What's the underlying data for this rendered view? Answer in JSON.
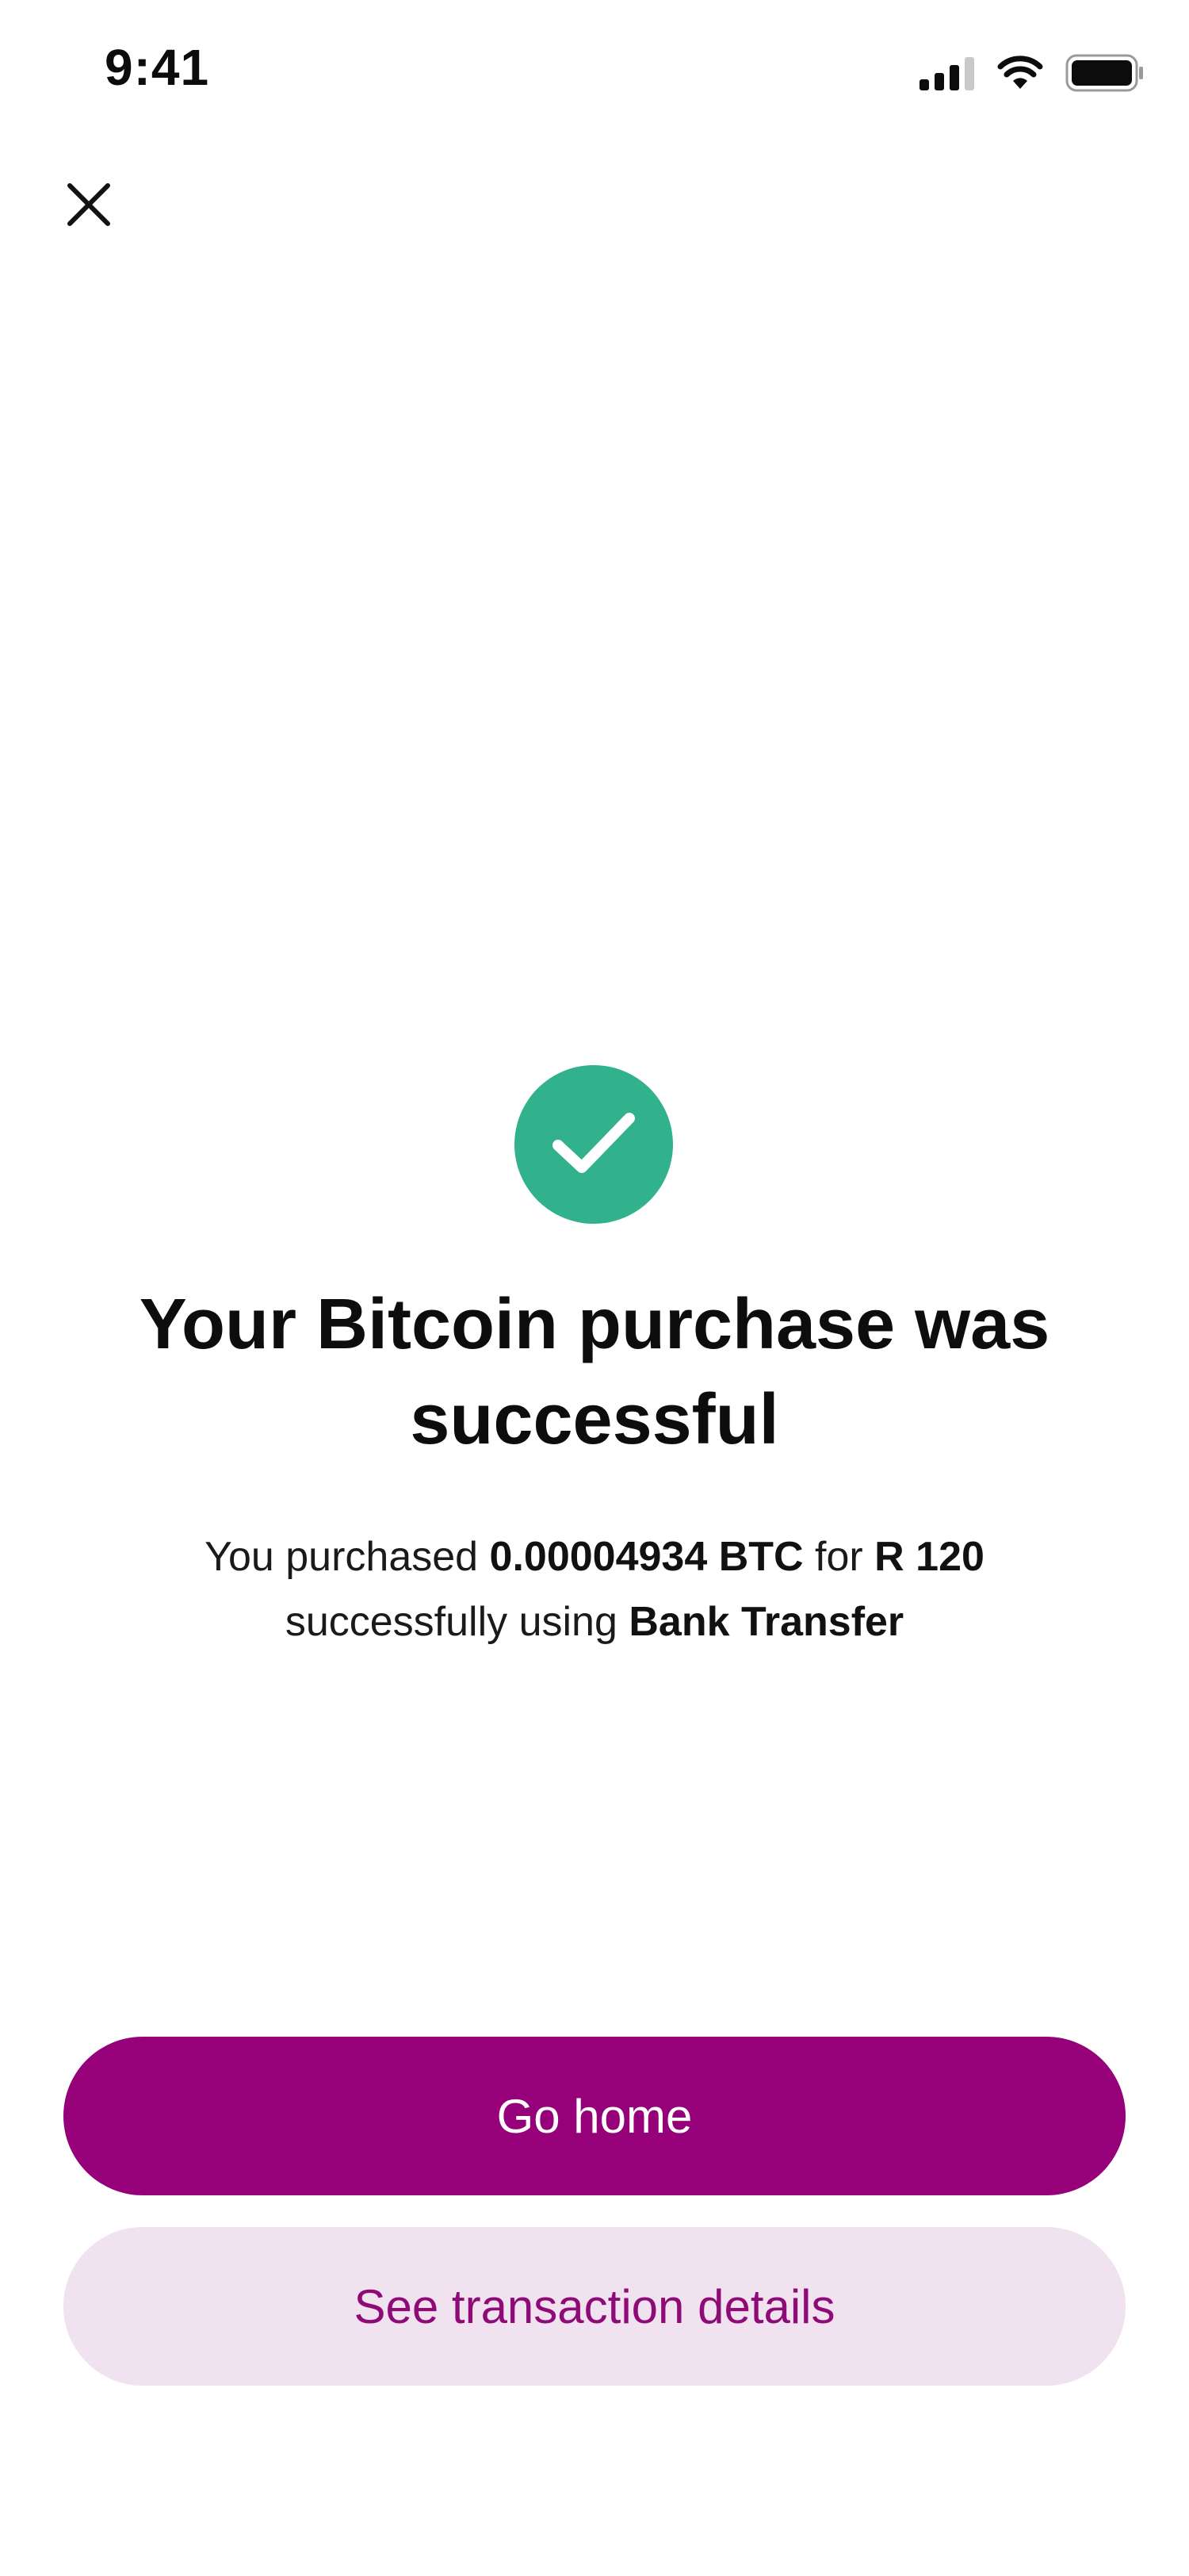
{
  "status_bar": {
    "time": "9:41",
    "icons": [
      "cellular-signal-icon",
      "wifi-icon",
      "battery-icon"
    ]
  },
  "header": {
    "close_icon": "close-icon"
  },
  "success": {
    "icon": "checkmark-icon",
    "icon_color": "#31b28c",
    "title": "Your Bitcoin purchase was successful",
    "message": {
      "prefix": "You purchased ",
      "amount": "0.00004934 BTC",
      "for_text": " for ",
      "price": "R 120",
      "using_text": " successfully using ",
      "method": "Bank Transfer"
    }
  },
  "actions": {
    "primary_label": "Go home",
    "primary_color": "#960079",
    "secondary_label": "See transaction details",
    "secondary_bg": "#f0e2ef"
  }
}
